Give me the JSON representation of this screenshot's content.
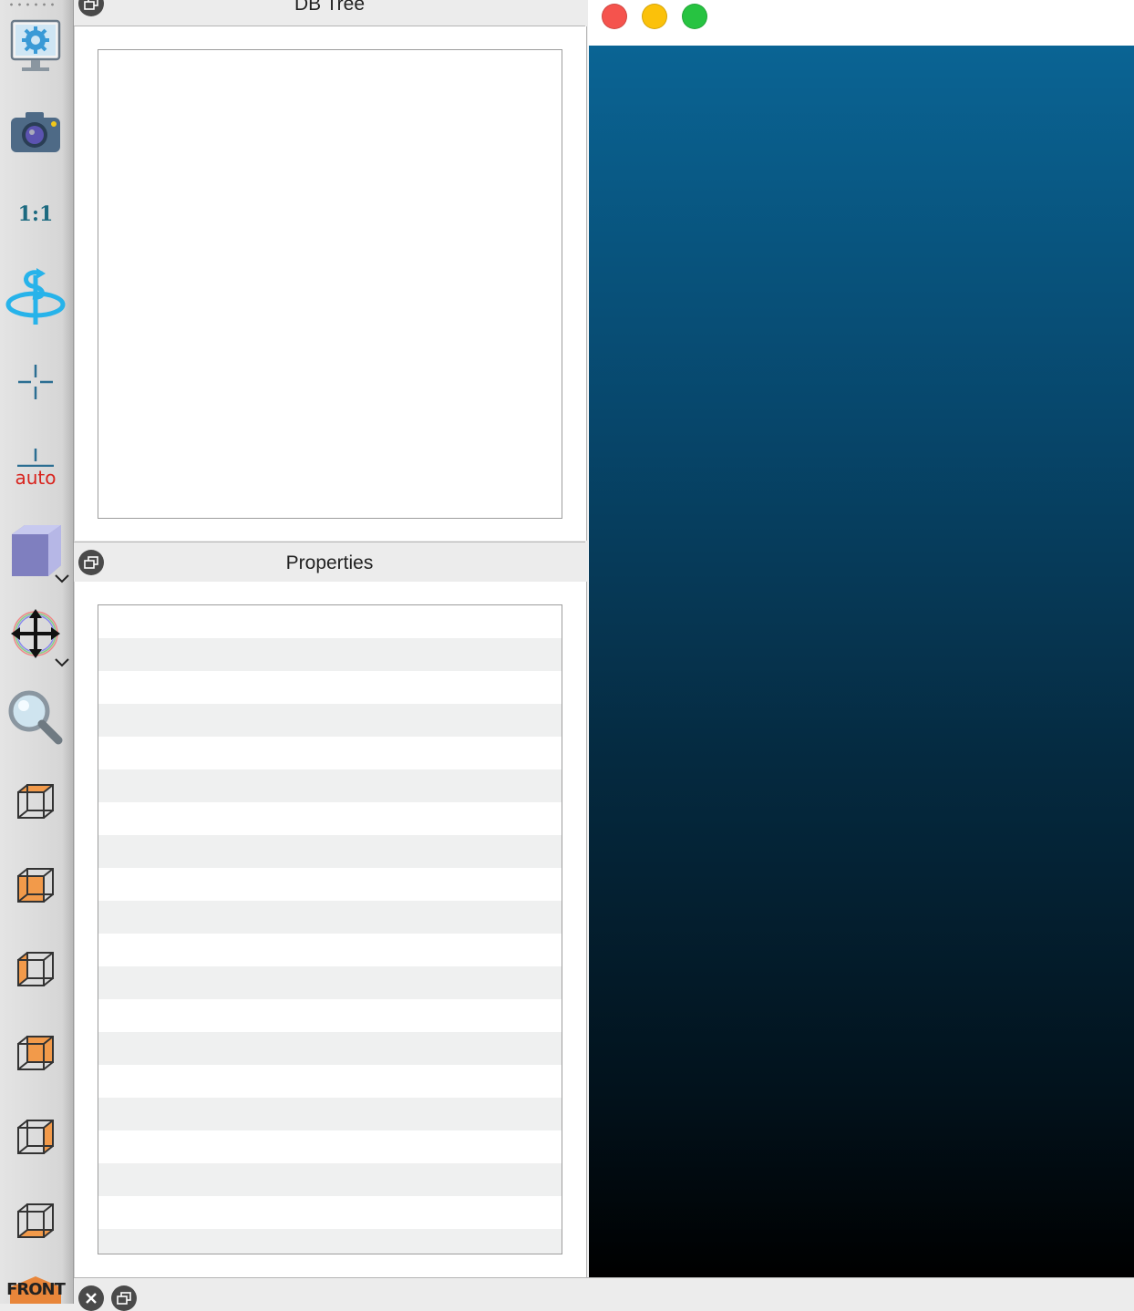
{
  "toolbar": {
    "tools": [
      {
        "name": "display-settings-icon"
      },
      {
        "name": "screenshot-camera-icon"
      },
      {
        "name": "zoom-1-1-icon",
        "label": "1:1"
      },
      {
        "name": "rotation-icon"
      },
      {
        "name": "pivot-point-icon"
      },
      {
        "name": "auto-pivot-icon",
        "label": "auto"
      },
      {
        "name": "bounding-box-icon"
      },
      {
        "name": "translate-rotate-icon"
      },
      {
        "name": "zoom-magnifier-icon"
      },
      {
        "name": "view-top-icon"
      },
      {
        "name": "view-front-filled-icon"
      },
      {
        "name": "view-left-icon"
      },
      {
        "name": "view-back-icon"
      },
      {
        "name": "view-right-icon"
      },
      {
        "name": "view-bottom-icon"
      },
      {
        "name": "view-front-cube-icon",
        "label": "FRONT"
      }
    ]
  },
  "db_tree": {
    "title": "DB Tree"
  },
  "properties": {
    "title": "Properties",
    "row_count": 20
  },
  "window_controls": {
    "close_color": "#f5534d",
    "minimize_color": "#fbc10a",
    "maximize_color": "#27c341"
  },
  "viewport": {
    "gradient_top": "#0a6494",
    "gradient_bottom": "#000000"
  }
}
